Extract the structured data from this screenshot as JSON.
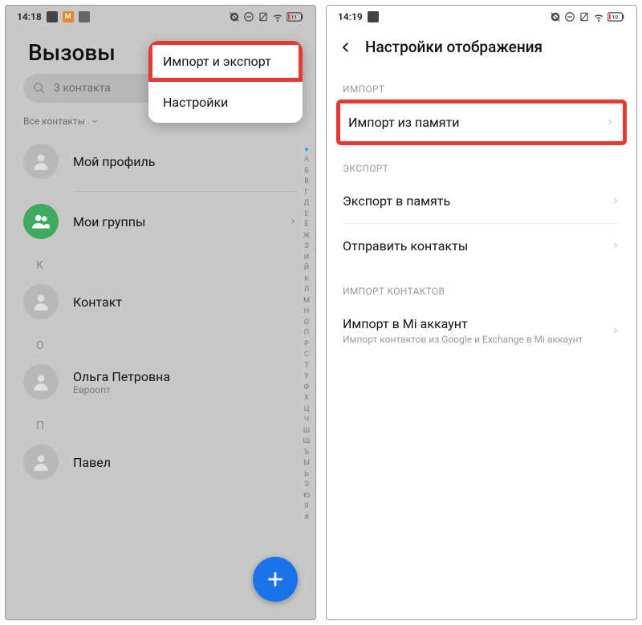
{
  "left": {
    "status": {
      "time": "14:18",
      "battery": "11"
    },
    "title": "Вызовы",
    "search_placeholder": "3 контакта",
    "filter_label": "Все контакты",
    "my_profile": "Мой профиль",
    "my_groups": "Мои группы",
    "letter_K": "К",
    "contact_k": "Контакт",
    "letter_O": "О",
    "contact_o_name": "Ольга Петровна",
    "contact_o_sub": "Евроопт",
    "letter_P": "П",
    "contact_p": "Павел",
    "popup": {
      "import_export": "Импорт и экспорт",
      "settings": "Настройки"
    },
    "index_letters": "АБВГДЕЁЖЗИЙКЛМНОПРСТУФХЦЧШЩЪЫЬЭЮЯ#"
  },
  "right": {
    "status": {
      "time": "14:19",
      "battery": "10"
    },
    "title": "Настройки отображения",
    "section_import": "ИМПОРТ",
    "import_from_storage": "Импорт из памяти",
    "section_export": "ЭКСПОРТ",
    "export_to_storage": "Экспорт в память",
    "send_contacts": "Отправить контакты",
    "section_import_contacts": "ИМПОРТ КОНТАКТОВ",
    "import_mi": "Импорт в Mi аккаунт",
    "import_mi_sub": "Импорт контактов из Google и Exchange в Mi аккаунт"
  }
}
